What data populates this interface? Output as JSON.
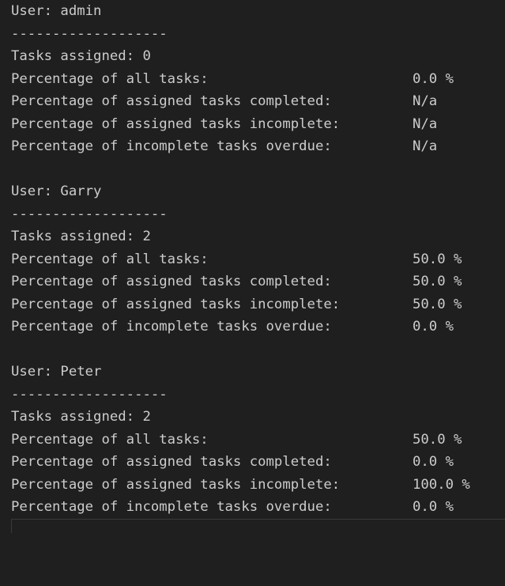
{
  "users": [
    {
      "header": "User: admin",
      "divider": "-------------------",
      "tasks_assigned": "Tasks assigned: 0",
      "stats": [
        {
          "label": "Percentage of all tasks:",
          "value": "0.0 %"
        },
        {
          "label": "Percentage of assigned tasks completed:",
          "value": "N/a"
        },
        {
          "label": "Percentage of assigned tasks incomplete:",
          "value": "N/a"
        },
        {
          "label": "Percentage of incomplete tasks overdue:",
          "value": "N/a"
        }
      ]
    },
    {
      "header": "User: Garry",
      "divider": "-------------------",
      "tasks_assigned": "Tasks assigned: 2",
      "stats": [
        {
          "label": "Percentage of all tasks:",
          "value": "50.0 %"
        },
        {
          "label": "Percentage of assigned tasks completed:",
          "value": "50.0 %"
        },
        {
          "label": "Percentage of assigned tasks incomplete:",
          "value": "50.0 %"
        },
        {
          "label": "Percentage of incomplete tasks overdue:",
          "value": "0.0 %"
        }
      ]
    },
    {
      "header": "User: Peter",
      "divider": "-------------------",
      "tasks_assigned": "Tasks assigned: 2",
      "stats": [
        {
          "label": "Percentage of all tasks:",
          "value": "50.0 %"
        },
        {
          "label": "Percentage of assigned tasks completed:",
          "value": "0.0 %"
        },
        {
          "label": "Percentage of assigned tasks incomplete:",
          "value": "100.0 %"
        },
        {
          "label": "Percentage of incomplete tasks overdue:",
          "value": "0.0 %"
        }
      ]
    }
  ]
}
